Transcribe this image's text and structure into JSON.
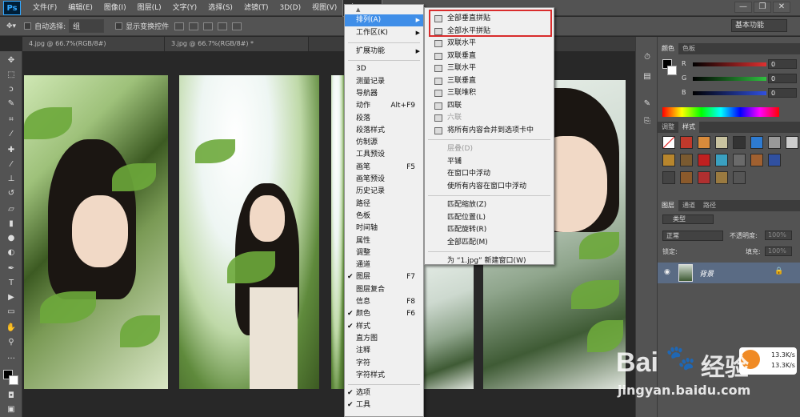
{
  "app": {
    "logo": "Ps"
  },
  "menubar": [
    "文件(F)",
    "编辑(E)",
    "图像(I)",
    "图层(L)",
    "文字(Y)",
    "选择(S)",
    "滤镜(T)",
    "3D(D)",
    "视图(V)",
    "窗口(W)"
  ],
  "active_menu": "窗口(W)",
  "window_controls": {
    "minimize": "—",
    "restore": "❐",
    "close": "✕"
  },
  "options_bar": {
    "auto_select_label": "自动选择:",
    "auto_select_value": "组",
    "show_transform_label": "显示变换控件"
  },
  "workspace": "基本功能",
  "tabs": [
    "4.jpg @ 66.7%(RGB/8#)",
    "3.jpg @ 66.7%(RGB/8#) *"
  ],
  "window_menu": {
    "items": [
      {
        "label": "排列(A)",
        "submenu": true,
        "highlighted": true
      },
      {
        "label": "工作区(K)",
        "submenu": true
      },
      {
        "sep": true
      },
      {
        "label": "扩展功能",
        "submenu": true
      },
      {
        "sep": true
      },
      {
        "label": "3D"
      },
      {
        "label": "测量记录"
      },
      {
        "label": "导航器"
      },
      {
        "label": "动作",
        "shortcut": "Alt+F9"
      },
      {
        "label": "段落"
      },
      {
        "label": "段落样式"
      },
      {
        "label": "仿制源"
      },
      {
        "label": "工具预设"
      },
      {
        "label": "画笔",
        "shortcut": "F5"
      },
      {
        "label": "画笔预设"
      },
      {
        "label": "历史记录"
      },
      {
        "label": "路径"
      },
      {
        "label": "色板"
      },
      {
        "label": "时间轴"
      },
      {
        "label": "属性"
      },
      {
        "label": "调整"
      },
      {
        "label": "通道"
      },
      {
        "label": "图层",
        "shortcut": "F7",
        "checked": true
      },
      {
        "label": "图层复合"
      },
      {
        "label": "信息",
        "shortcut": "F8"
      },
      {
        "label": "颜色",
        "shortcut": "F6",
        "checked": true
      },
      {
        "label": "样式",
        "checked": true
      },
      {
        "label": "直方图"
      },
      {
        "label": "注释"
      },
      {
        "label": "字符"
      },
      {
        "label": "字符样式"
      },
      {
        "sep": true
      },
      {
        "label": "选项",
        "checked": true
      },
      {
        "label": "工具",
        "checked": true
      }
    ]
  },
  "arrange_submenu": {
    "items": [
      {
        "label": "全部垂直拼贴",
        "icon": true,
        "boxed": true
      },
      {
        "label": "全部水平拼贴",
        "icon": true,
        "boxed": true
      },
      {
        "label": "双联水平",
        "icon": true
      },
      {
        "label": "双联垂直",
        "icon": true
      },
      {
        "label": "三联水平",
        "icon": true
      },
      {
        "label": "三联垂直",
        "icon": true
      },
      {
        "label": "三联堆积",
        "icon": true
      },
      {
        "label": "四联",
        "icon": true
      },
      {
        "label": "六联",
        "icon": true,
        "disabled": true
      },
      {
        "label": "将所有内容合并到选项卡中",
        "icon": true
      },
      {
        "sep": true
      },
      {
        "label": "层叠(D)",
        "disabled": true
      },
      {
        "label": "平铺"
      },
      {
        "label": "在窗口中浮动"
      },
      {
        "label": "使所有内容在窗口中浮动"
      },
      {
        "sep": true
      },
      {
        "label": "匹配缩放(Z)"
      },
      {
        "label": "匹配位置(L)"
      },
      {
        "label": "匹配旋转(R)"
      },
      {
        "label": "全部匹配(M)"
      },
      {
        "sep": true
      },
      {
        "label": "为 “1.jpg” 新建窗口(W)"
      }
    ]
  },
  "color_panel": {
    "tabs": [
      "颜色",
      "色板"
    ],
    "channels": [
      {
        "label": "R",
        "value": "0",
        "color": "#e03030"
      },
      {
        "label": "G",
        "value": "0",
        "color": "#30c040"
      },
      {
        "label": "B",
        "value": "0",
        "color": "#3050e0"
      }
    ]
  },
  "styles_panel": {
    "tabs": [
      "调整",
      "样式"
    ]
  },
  "layers_panel": {
    "tabs": [
      "图层",
      "通道",
      "路径"
    ],
    "kind_filter": "类型",
    "blend_mode": "正常",
    "opacity_label": "不透明度:",
    "opacity_value": "100%",
    "lock_label": "锁定:",
    "fill_label": "填充:",
    "fill_value": "100%",
    "layer_name": "背景"
  },
  "network_widget": {
    "up": "13.3K/s",
    "down": "13.3K/s"
  },
  "watermark": {
    "brand": "Bai",
    "brand2": "经验",
    "url": "jingyan.baidu.com"
  }
}
